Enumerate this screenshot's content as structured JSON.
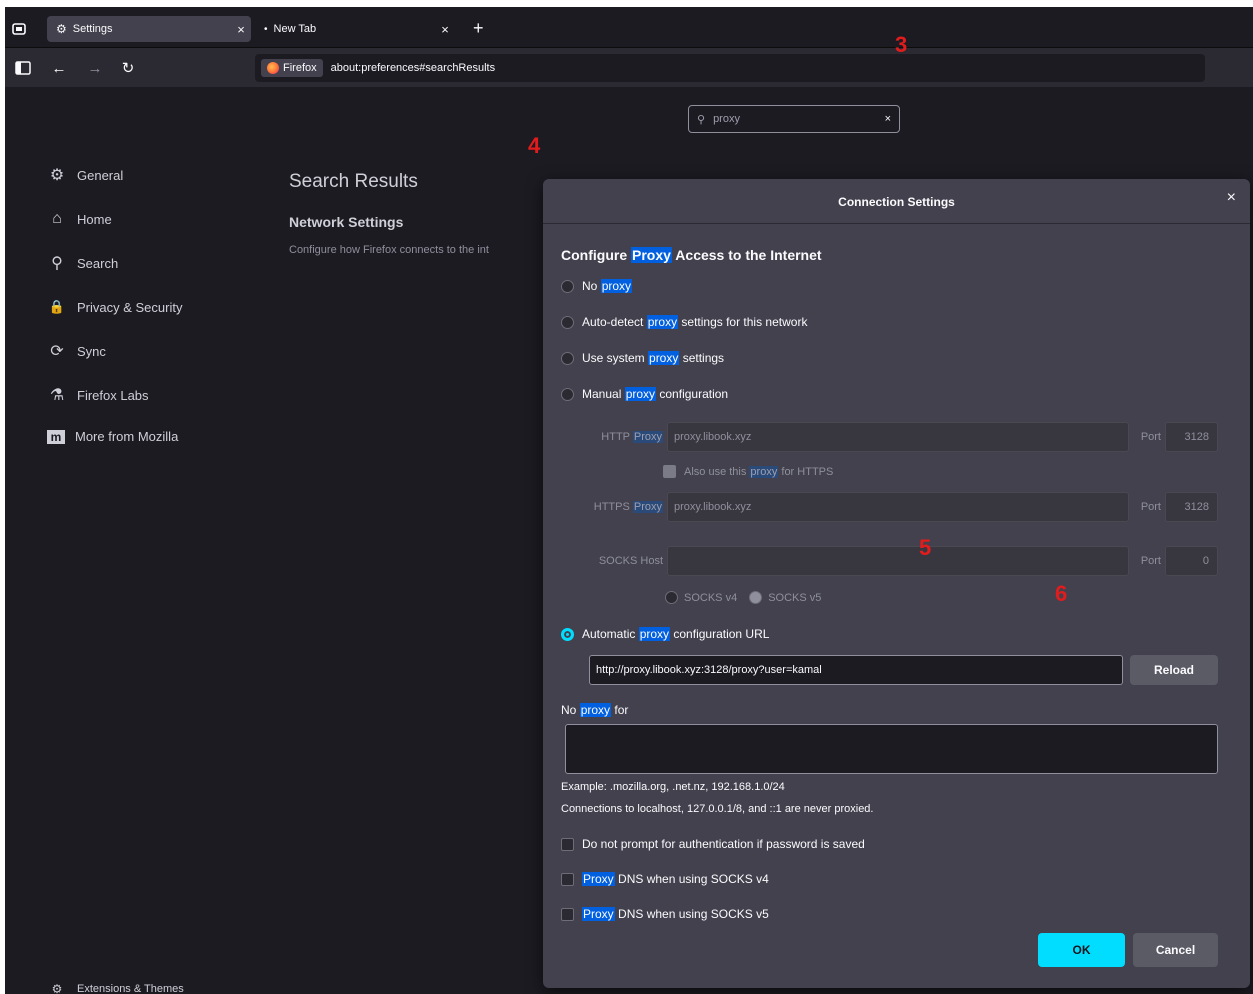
{
  "tabs": [
    {
      "label": "Settings",
      "icon": "gear-icon",
      "close": "×"
    },
    {
      "label": "New Tab",
      "icon": "dot-icon",
      "close": "×"
    }
  ],
  "new_tab_symbol": "+",
  "urlbar": {
    "chip_label": "Firefox",
    "url": "about:preferences#searchResults"
  },
  "search": {
    "value": "proxy",
    "clear": "×"
  },
  "sidebar": {
    "items": [
      {
        "label": "General",
        "icon": "gear-icon",
        "glyph": "⚙"
      },
      {
        "label": "Home",
        "icon": "home-icon",
        "glyph": "⌂"
      },
      {
        "label": "Search",
        "icon": "search-icon",
        "glyph": "⚲"
      },
      {
        "label": "Privacy & Security",
        "icon": "lock-icon",
        "glyph": "🔒"
      },
      {
        "label": "Sync",
        "icon": "sync-icon",
        "glyph": "⟳"
      },
      {
        "label": "Firefox Labs",
        "icon": "labs-icon",
        "glyph": "⚗"
      },
      {
        "label": "More from Mozilla",
        "icon": "mozilla-icon",
        "glyph": "m"
      }
    ],
    "footer": "Extensions & Themes"
  },
  "main": {
    "title": "Search Results",
    "section_title": "Network Settings",
    "section_desc": "Configure how Firefox connects to the int"
  },
  "annotations": [
    "3",
    "4",
    "5",
    "6"
  ],
  "dialog": {
    "title": "Connection Settings",
    "close": "×",
    "heading_pre": "Configure ",
    "heading_hl": "Proxy",
    "heading_post": " Access to the Internet",
    "options": {
      "no_proxy": {
        "pre": "No ",
        "hl": "proxy",
        "post": ""
      },
      "auto_detect": {
        "pre": "Auto-detect ",
        "hl": "proxy",
        "post": " settings for this network"
      },
      "system": {
        "pre": "Use system ",
        "hl": "proxy",
        "post": " settings"
      },
      "manual": {
        "pre": "Manual ",
        "hl": "proxy",
        "post": " configuration"
      },
      "automatic": {
        "pre": "Automatic ",
        "hl": "proxy",
        "post": " configuration URL"
      }
    },
    "http_proxy": {
      "label_pre": "HTTP ",
      "label_hl": "Proxy",
      "value": "proxy.libook.xyz",
      "port_label": "Port",
      "port": "3128"
    },
    "also_https": {
      "pre": "Also use this ",
      "hl": "proxy",
      "post": " for HTTPS"
    },
    "https_proxy": {
      "label_pre": "HTTPS ",
      "label_hl": "Proxy",
      "value": "proxy.libook.xyz",
      "port_label": "Port",
      "port": "3128"
    },
    "socks": {
      "label": "SOCKS Host",
      "value": "",
      "port_label": "Port",
      "port": "0",
      "v4": "SOCKS v4",
      "v5": "SOCKS v5"
    },
    "pac_url": "http://proxy.libook.xyz:3128/proxy?user=kamal",
    "reload": "Reload",
    "no_proxy_for": {
      "pre": "No ",
      "hl": "proxy",
      "post": " for"
    },
    "no_proxy_value": "",
    "example": "Example: .mozilla.org, .net.nz, 192.168.1.0/24",
    "localhost_note": "Connections to localhost, 127.0.0.1/8, and ::1 are never proxied.",
    "checks": {
      "no_prompt": "Do not prompt for authentication if password is saved",
      "dns_v4": {
        "hl": "Proxy",
        "post": " DNS when using SOCKS v4"
      },
      "dns_v5": {
        "hl": "Proxy",
        "post": " DNS when using SOCKS v5"
      }
    },
    "ok": "OK",
    "cancel": "Cancel"
  },
  "colors": {
    "accent": "#00ddff",
    "highlight": "#0060df",
    "annotation": "#e21c1c",
    "background": "#1c1b22",
    "dialog": "#42414d"
  }
}
